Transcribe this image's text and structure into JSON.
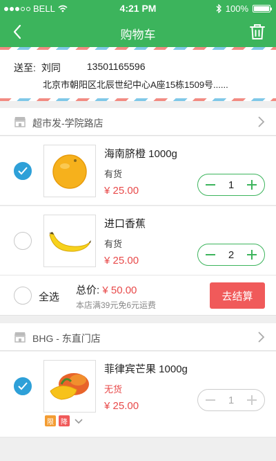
{
  "status_bar": {
    "carrier": "BELL",
    "time": "4:21 PM",
    "battery": "100%"
  },
  "nav": {
    "title": "购物车",
    "back_icon": "chevron-left-icon",
    "trash_icon": "trash-icon"
  },
  "address": {
    "to_label": "送至:",
    "name": "刘同",
    "phone": "13501165596",
    "detail": "北京市朝阳区北辰世纪中心A座15栋1509号......"
  },
  "stores": [
    {
      "name": "超市发-学院路店",
      "items": [
        {
          "name": "海南脐橙 1000g",
          "stock": "有货",
          "price": "¥ 25.00",
          "qty": "1",
          "checked": true
        },
        {
          "name": "进口香蕉",
          "stock": "有货",
          "price": "¥ 25.00",
          "qty": "2",
          "checked": false
        }
      ],
      "summary": {
        "select_all": "全选",
        "total_label": "总价:",
        "total_amount": "¥ 50.00",
        "shipping_note": "本店满39元免6元运费",
        "checkout": "去结算"
      }
    },
    {
      "name": "BHG - 东直门店",
      "items": [
        {
          "name": "菲律宾芒果 1000g",
          "stock": "无货",
          "price": "¥ 25.00",
          "qty": "1",
          "checked": true,
          "tags": [
            "限",
            "降"
          ]
        }
      ]
    }
  ],
  "colors": {
    "primary": "#3cb45c",
    "accent_red": "#f05a5a",
    "check_blue": "#2ea0d8"
  }
}
